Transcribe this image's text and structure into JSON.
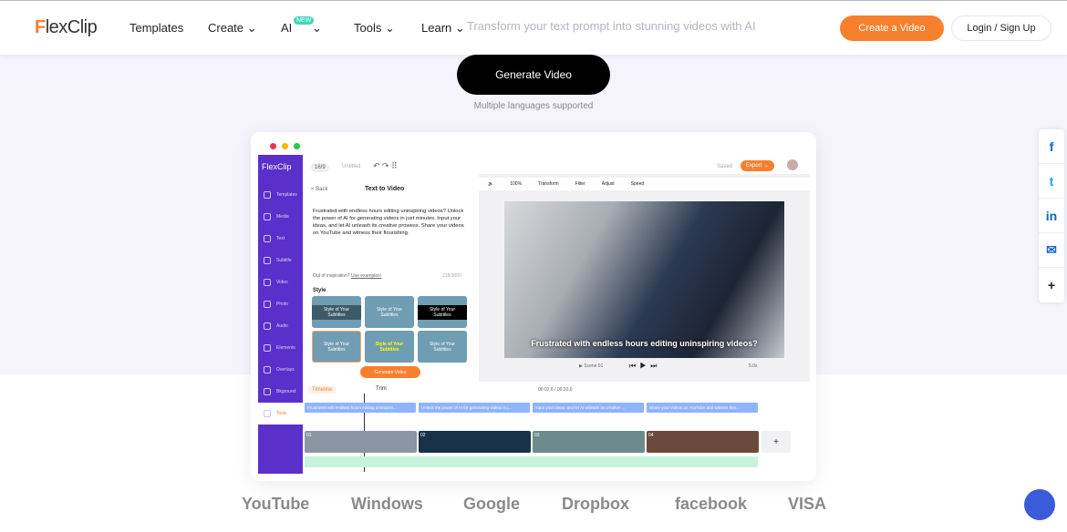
{
  "header": {
    "logo": "FlexClip",
    "nav": [
      "Templates",
      "Create",
      "AI",
      "Tools",
      "Learn"
    ],
    "new_badge": "NEW",
    "create_button": "Create a Video",
    "login_button": "Login / Sign Up"
  },
  "hero": {
    "subtitle": "Transform your text prompt into stunning videos with AI",
    "generate_button": "Generate Video",
    "note": "Multiple languages supported"
  },
  "share": {
    "icons": [
      "facebook-icon",
      "twitter-icon",
      "linkedin-icon",
      "email-icon",
      "plus-icon"
    ],
    "labels": [
      "f",
      "t",
      "in",
      "✉",
      "+"
    ]
  },
  "editor": {
    "logo": "FlexClip",
    "ratio": "16/9",
    "project": "Untitled",
    "saved": "Saved",
    "export": "Export →",
    "sidebar": [
      "Templates",
      "Media",
      "Text",
      "Subtitle",
      "Video",
      "Photo",
      "Audio",
      "Elements",
      "Overlays",
      "Bkground",
      "Tools"
    ],
    "panel": {
      "back": "< Back",
      "title": "Text to Video",
      "text": "Frustrated with endless hours editing uninspiring videos? Unlock the power of AI for generating videos in just minutes. Input your ideas, and let AI unleash its creative prowess. Share your videos on YouTube and witness their flourishing.",
      "inspiration": "Out of inspiration?",
      "use_examples": "Use examples!",
      "count": "218/3000",
      "style_label": "Style",
      "style_text": "Style of Your Subtitles",
      "generate": "Generate Video"
    },
    "toolbar": {
      "zoom": "100%",
      "items": [
        "Transform",
        "Filter",
        "Adjust",
        "Speed"
      ]
    },
    "caption": "Frustrated with endless hours editing uninspiring videos?",
    "scene": "▶ Scene 01",
    "duration": "5.0s",
    "timeline": {
      "label": "Timeline",
      "trim": "Trim",
      "time": "00:02.6 / 00:20.0",
      "subtitles": [
        "Frustrated with endless hours editing uninspirin...",
        "Unlock the power of AI for generating videos in j...",
        "Input your ideas, and let AI unleash its creative ...",
        "Share your videos on YouTube and witness thei..."
      ],
      "clips": [
        "01",
        "02",
        "03",
        "04"
      ]
    }
  },
  "brands": [
    "YouTube",
    "Windows",
    "Google",
    "Dropbox",
    "facebook",
    "VISA"
  ],
  "colors": {
    "accent": "#f7802f",
    "sidebar": "#5b2fc9",
    "hero_bg": "#f5f4fd"
  }
}
